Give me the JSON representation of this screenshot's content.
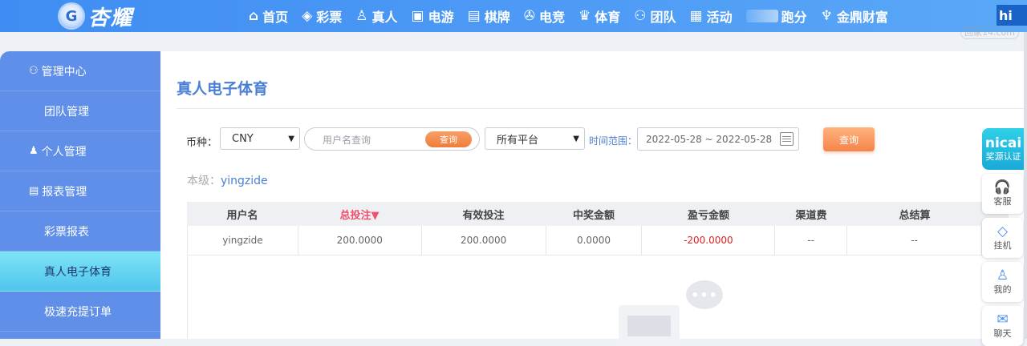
{
  "brand": {
    "name": "杏耀",
    "badge_char": "G"
  },
  "nav": {
    "items": [
      {
        "icon": "⌂",
        "icon_name": "home-icon",
        "label": "首页"
      },
      {
        "icon": "◈",
        "icon_name": "ticket-icon",
        "label": "彩票"
      },
      {
        "icon": "♙",
        "icon_name": "person-icon",
        "label": "真人"
      },
      {
        "icon": "▣",
        "icon_name": "slot-machine-icon",
        "label": "电游"
      },
      {
        "icon": "▤",
        "icon_name": "cards-icon",
        "label": "棋牌"
      },
      {
        "icon": "✇",
        "icon_name": "gamepad-icon",
        "label": "电竞"
      },
      {
        "icon": "♛",
        "icon_name": "trophy-icon",
        "label": "体育"
      },
      {
        "icon": "⚇",
        "icon_name": "team-icon",
        "label": "团队"
      },
      {
        "icon": "▦",
        "icon_name": "gift-icon",
        "label": "活动"
      },
      {
        "icon": "",
        "icon_name": "car-icon",
        "label": "跑分"
      },
      {
        "icon": "♆",
        "icon_name": "wealth-icon",
        "label": "金鼎财富"
      }
    ],
    "last_partial": "hi"
  },
  "watermark": "回家14.com",
  "sidebar": {
    "items": [
      {
        "type": "head",
        "icon": "⚇",
        "icon_name": "users-icon",
        "label": "管理中心"
      },
      {
        "type": "sub",
        "label": "团队管理"
      },
      {
        "type": "head",
        "icon": "♟",
        "icon_name": "user-icon",
        "label": "个人管理"
      },
      {
        "type": "head",
        "icon": "▤",
        "icon_name": "report-icon",
        "label": "报表管理"
      },
      {
        "type": "sub",
        "label": "彩票报表"
      },
      {
        "type": "sub",
        "label": "真人电子体育",
        "active": true
      },
      {
        "type": "sub",
        "label": "极速充提订单"
      }
    ]
  },
  "main": {
    "title": "真人电子体育",
    "filters": {
      "currency_label": "币种：",
      "currency_value": "CNY",
      "search_placeholder": "用户名查询",
      "search_button": "查询",
      "platform_value": "所有平台",
      "time_label": "时间范围：",
      "date_range": "2022-05-28 ~ 2022-05-28",
      "query_button": "查询"
    },
    "level_label": "本级：",
    "level_value": "yingzide",
    "table": {
      "headers": [
        "用户名",
        "总投注▼",
        "有效投注",
        "中奖金额",
        "盈亏金额",
        "渠道费",
        "总结算",
        ""
      ],
      "rows": [
        [
          "yingzide",
          "200.0000",
          "200.0000",
          "0.0000",
          "-200.0000",
          "--",
          "--",
          ""
        ]
      ]
    },
    "empty_bubble": "•••"
  },
  "float_bar": {
    "promo_big": "nicai",
    "promo_small": "奖源认证",
    "items": [
      {
        "icon": "🎧",
        "icon_name": "headset-icon",
        "label": "客服"
      },
      {
        "icon": "◇",
        "icon_name": "diamond-icon",
        "label": "挂机"
      },
      {
        "icon": "♙",
        "icon_name": "profile-icon",
        "label": "我的"
      },
      {
        "icon": "✉",
        "icon_name": "chat-icon",
        "label": "聊天"
      }
    ]
  },
  "colors": {
    "accent": "#4a7fd6",
    "nav_bg": "#4f9cf6",
    "sidebar_bg": "#5f8fe9",
    "active_item": "#4fc6ec",
    "button_orange": "#f5844a",
    "negative": "#e02020"
  }
}
